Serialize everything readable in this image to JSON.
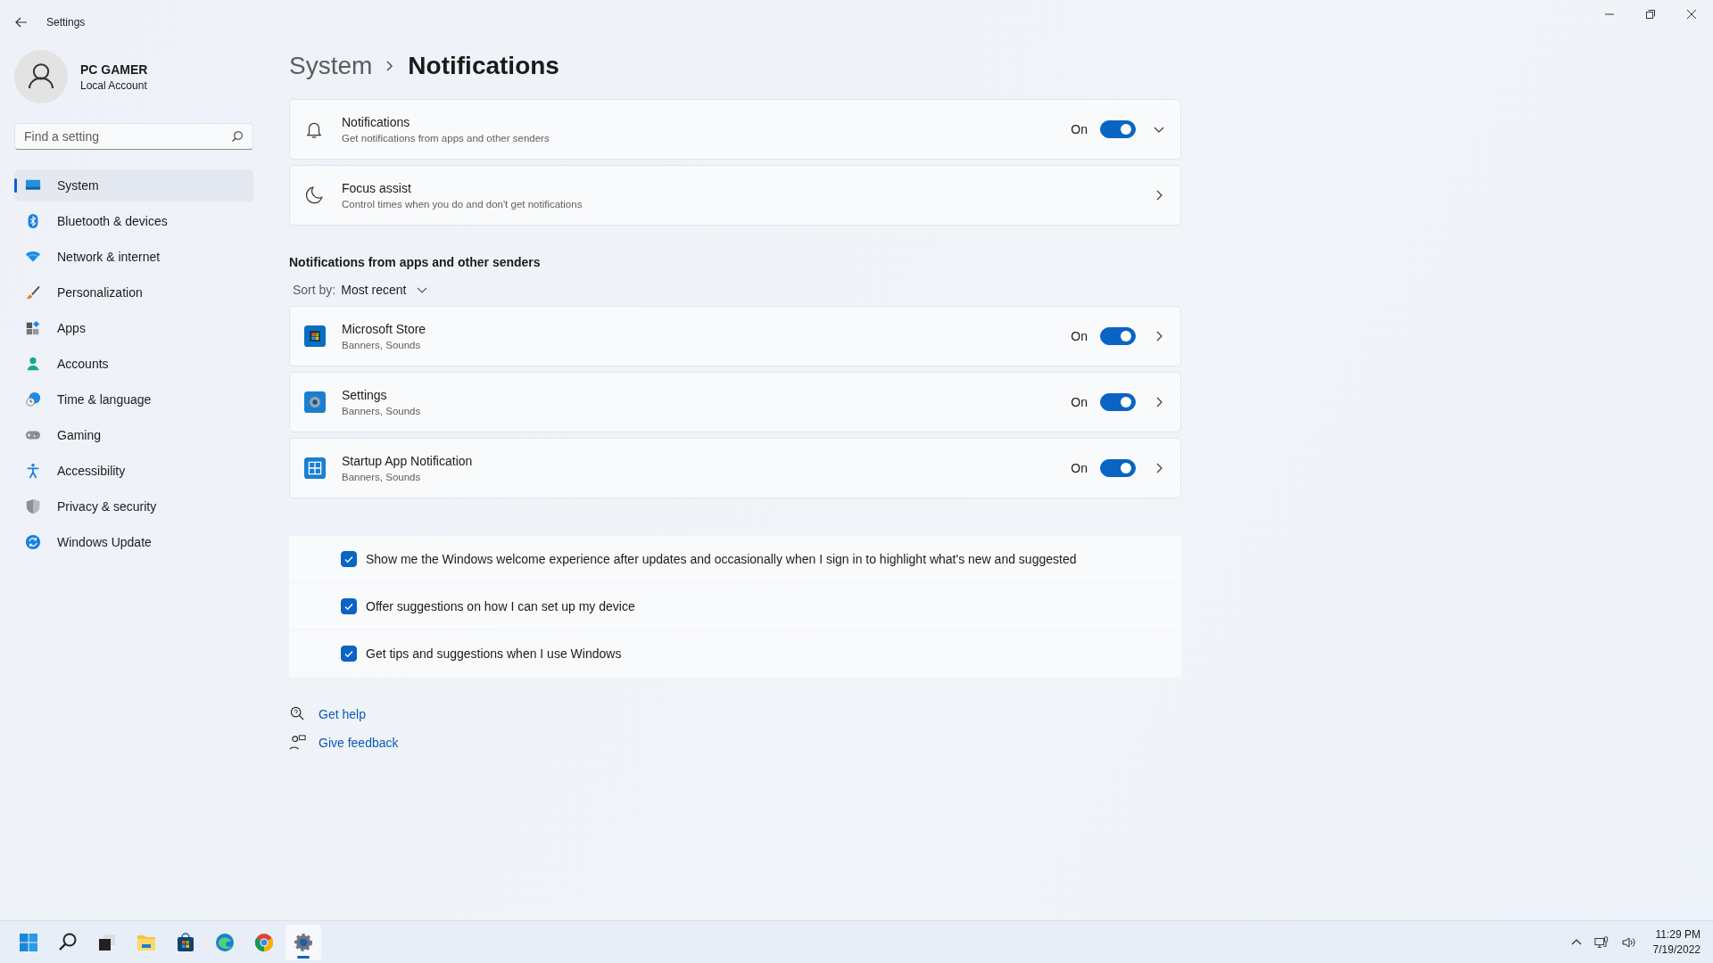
{
  "window": {
    "title": "Settings"
  },
  "profile": {
    "name": "PC GAMER",
    "account": "Local Account"
  },
  "search": {
    "placeholder": "Find a setting"
  },
  "nav": [
    {
      "label": "System",
      "selected": true
    },
    {
      "label": "Bluetooth & devices",
      "selected": false
    },
    {
      "label": "Network & internet",
      "selected": false
    },
    {
      "label": "Personalization",
      "selected": false
    },
    {
      "label": "Apps",
      "selected": false
    },
    {
      "label": "Accounts",
      "selected": false
    },
    {
      "label": "Time & language",
      "selected": false
    },
    {
      "label": "Gaming",
      "selected": false
    },
    {
      "label": "Accessibility",
      "selected": false
    },
    {
      "label": "Privacy & security",
      "selected": false
    },
    {
      "label": "Windows Update",
      "selected": false
    }
  ],
  "breadcrumb": {
    "parent": "System",
    "current": "Notifications"
  },
  "settings": [
    {
      "kind": "expander",
      "title": "Notifications",
      "subtitle": "Get notifications from apps and other senders",
      "state_label": "On",
      "on": true
    },
    {
      "kind": "link",
      "title": "Focus assist",
      "subtitle": "Control times when you do and don't get notifications"
    }
  ],
  "section_heading": "Notifications from apps and other senders",
  "sort": {
    "label": "Sort by:",
    "value": "Most recent"
  },
  "apps": [
    {
      "name": "Microsoft Store",
      "detail": "Banners, Sounds",
      "state_label": "On",
      "on": true
    },
    {
      "name": "Settings",
      "detail": "Banners, Sounds",
      "state_label": "On",
      "on": true
    },
    {
      "name": "Startup App Notification",
      "detail": "Banners, Sounds",
      "state_label": "On",
      "on": true
    }
  ],
  "options": [
    {
      "text": "Show me the Windows welcome experience after updates and occasionally when I sign in to highlight what's new and suggested",
      "checked": true
    },
    {
      "text": "Offer suggestions on how I can set up my device",
      "checked": true
    },
    {
      "text": "Get tips and suggestions when I use Windows",
      "checked": true
    }
  ],
  "links": [
    {
      "kind": "help",
      "label": "Get help"
    },
    {
      "kind": "feedback",
      "label": "Give feedback"
    }
  ],
  "taskbar": {
    "apps": [
      {
        "selected": false
      },
      {
        "selected": false
      },
      {
        "selected": false
      },
      {
        "selected": false
      },
      {
        "selected": false
      },
      {
        "selected": false
      },
      {
        "selected": false
      },
      {
        "selected": true
      }
    ],
    "time": "11:29 PM",
    "date": "7/19/2022"
  }
}
